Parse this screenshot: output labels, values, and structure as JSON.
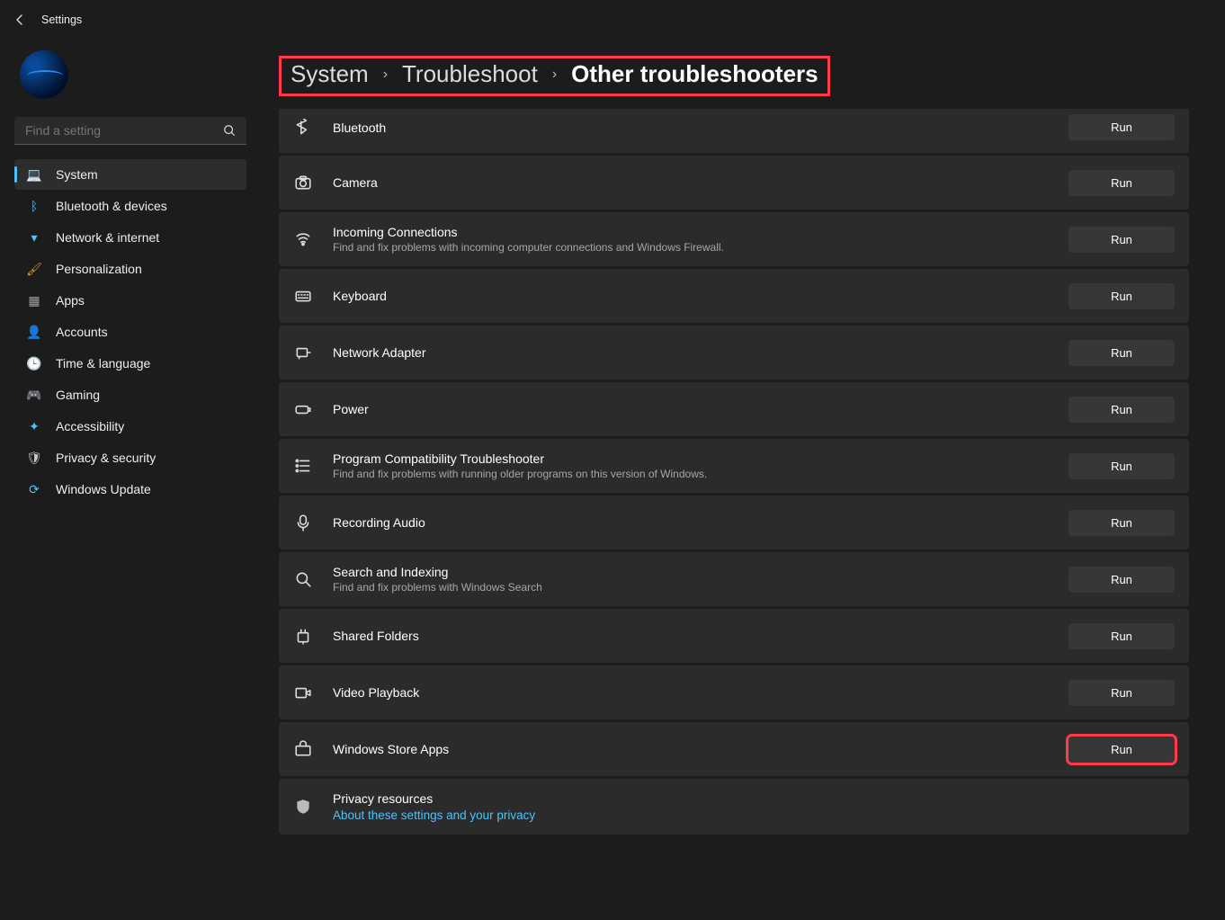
{
  "app": {
    "title": "Settings"
  },
  "search": {
    "placeholder": "Find a setting"
  },
  "nav": [
    {
      "label": "System",
      "icon": "💻",
      "color": "#4cc2ff",
      "active": true
    },
    {
      "label": "Bluetooth & devices",
      "icon": "ᛒ",
      "color": "#4cc2ff"
    },
    {
      "label": "Network & internet",
      "icon": "▾",
      "color": "#4cc2ff"
    },
    {
      "label": "Personalization",
      "icon": "🖌",
      "color": "#d9a23a"
    },
    {
      "label": "Apps",
      "icon": "▦",
      "color": "#9aa0a6"
    },
    {
      "label": "Accounts",
      "icon": "👤",
      "color": "#2ec27e"
    },
    {
      "label": "Time & language",
      "icon": "🕒",
      "color": "#d9d9d9"
    },
    {
      "label": "Gaming",
      "icon": "🎮",
      "color": "#bdbdbd"
    },
    {
      "label": "Accessibility",
      "icon": "✦",
      "color": "#4cc2ff"
    },
    {
      "label": "Privacy & security",
      "icon": "🛡",
      "color": "#c7c7c7"
    },
    {
      "label": "Windows Update",
      "icon": "⟳",
      "color": "#4cc2ff"
    }
  ],
  "breadcrumb": {
    "seg1": "System",
    "seg2": "Troubleshoot",
    "current": "Other troubleshooters"
  },
  "run_label": "Run",
  "items": [
    {
      "title": "Bluetooth",
      "icon": "bluetooth",
      "partial": true
    },
    {
      "title": "Camera",
      "icon": "camera"
    },
    {
      "title": "Incoming Connections",
      "icon": "signal",
      "desc": "Find and fix problems with incoming computer connections and Windows Firewall."
    },
    {
      "title": "Keyboard",
      "icon": "keyboard"
    },
    {
      "title": "Network Adapter",
      "icon": "adapter"
    },
    {
      "title": "Power",
      "icon": "battery"
    },
    {
      "title": "Program Compatibility Troubleshooter",
      "icon": "list",
      "desc": "Find and fix problems with running older programs on this version of Windows."
    },
    {
      "title": "Recording Audio",
      "icon": "mic"
    },
    {
      "title": "Search and Indexing",
      "icon": "search",
      "desc": "Find and fix problems with Windows Search"
    },
    {
      "title": "Shared Folders",
      "icon": "folder"
    },
    {
      "title": "Video Playback",
      "icon": "video"
    },
    {
      "title": "Windows Store Apps",
      "icon": "store",
      "highlight": true
    }
  ],
  "privacy": {
    "title": "Privacy resources",
    "link": "About these settings and your privacy"
  }
}
